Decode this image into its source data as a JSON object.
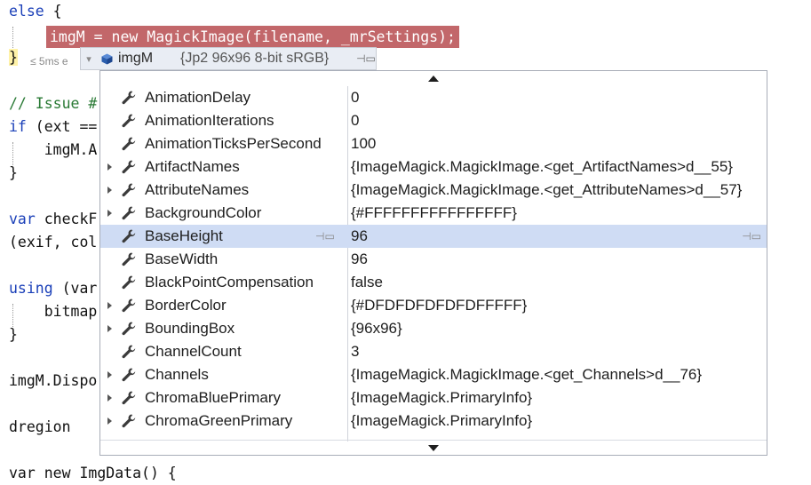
{
  "code": {
    "lines": [
      {
        "pre": "",
        "kw": "else",
        "post": " {"
      },
      {
        "pre": "",
        "kw": "",
        "post": ""
      },
      {
        "pre": "",
        "kw": "",
        "post": "}"
      },
      {
        "pre": "",
        "kw": "",
        "post": ""
      },
      {
        "pre": "",
        "kw": "",
        "post": "// Issue #"
      },
      {
        "pre": "",
        "kw": "if",
        "post": " (ext =="
      },
      {
        "pre": "    ",
        "kw": "",
        "post": "imgM.A"
      },
      {
        "pre": "",
        "kw": "",
        "post": "}"
      },
      {
        "pre": "",
        "kw": "",
        "post": ""
      },
      {
        "pre": "",
        "kw": "var",
        "post": " checkF"
      },
      {
        "pre": "",
        "kw": "",
        "post": "(exif, col"
      },
      {
        "pre": "",
        "kw": "",
        "post": ""
      },
      {
        "pre": "",
        "kw": "using",
        "post": " (var"
      },
      {
        "pre": "    ",
        "kw": "",
        "post": "bitmap"
      },
      {
        "pre": "",
        "kw": "",
        "post": "}"
      },
      {
        "pre": "",
        "kw": "",
        "post": ""
      },
      {
        "pre": "",
        "kw": "",
        "post": "imgM.Dispo"
      },
      {
        "pre": "",
        "kw": "",
        "post": ""
      },
      {
        "pre": "",
        "kw": "",
        "post": "dregion"
      },
      {
        "pre": "",
        "kw": "",
        "post": ""
      },
      {
        "pre": "",
        "kw": "",
        "post": "var new ImgData() {"
      }
    ],
    "highlighted_statement": "imgM = new MagickImage(filename, _mrSettings);",
    "perf_tip": "≤ 5ms e"
  },
  "datatip": {
    "variable_name": "imgM",
    "variable_value": "{Jp2 96x96 8-bit sRGB}",
    "pin_glyph": "⊣▭",
    "properties": [
      {
        "name": "AnimationDelay",
        "value": "0",
        "expandable": false,
        "selected": false
      },
      {
        "name": "AnimationIterations",
        "value": "0",
        "expandable": false,
        "selected": false
      },
      {
        "name": "AnimationTicksPerSecond",
        "value": "100",
        "expandable": false,
        "selected": false
      },
      {
        "name": "ArtifactNames",
        "value": "{ImageMagick.MagickImage.<get_ArtifactNames>d__55}",
        "expandable": true,
        "selected": false
      },
      {
        "name": "AttributeNames",
        "value": "{ImageMagick.MagickImage.<get_AttributeNames>d__57}",
        "expandable": true,
        "selected": false
      },
      {
        "name": "BackgroundColor",
        "value": "{#FFFFFFFFFFFFFFFF}",
        "expandable": true,
        "selected": false
      },
      {
        "name": "BaseHeight",
        "value": "96",
        "expandable": false,
        "selected": true
      },
      {
        "name": "BaseWidth",
        "value": "96",
        "expandable": false,
        "selected": false
      },
      {
        "name": "BlackPointCompensation",
        "value": "false",
        "expandable": false,
        "selected": false
      },
      {
        "name": "BorderColor",
        "value": "{#DFDFDFDFDFDFFFFF}",
        "expandable": true,
        "selected": false
      },
      {
        "name": "BoundingBox",
        "value": "{96x96}",
        "expandable": true,
        "selected": false
      },
      {
        "name": "ChannelCount",
        "value": "3",
        "expandable": false,
        "selected": false
      },
      {
        "name": "Channels",
        "value": "{ImageMagick.MagickImage.<get_Channels>d__76}",
        "expandable": true,
        "selected": false
      },
      {
        "name": "ChromaBluePrimary",
        "value": "{ImageMagick.PrimaryInfo}",
        "expandable": true,
        "selected": false
      },
      {
        "name": "ChromaGreenPrimary",
        "value": "{ImageMagick.PrimaryInfo}",
        "expandable": true,
        "selected": false
      }
    ]
  },
  "colors": {
    "keyword": "#1a3fb8",
    "comment": "#2a7a35",
    "statement_highlight": "#c2676a",
    "selected_row": "#cfdcf4"
  },
  "icons": {
    "variable": "object-cube-icon",
    "property": "wrench-property-icon",
    "pin": "pin-icon",
    "expand": "expand-triangle-icon",
    "scroll_up": "scroll-up-arrow-icon",
    "scroll_down": "scroll-down-arrow-icon"
  }
}
